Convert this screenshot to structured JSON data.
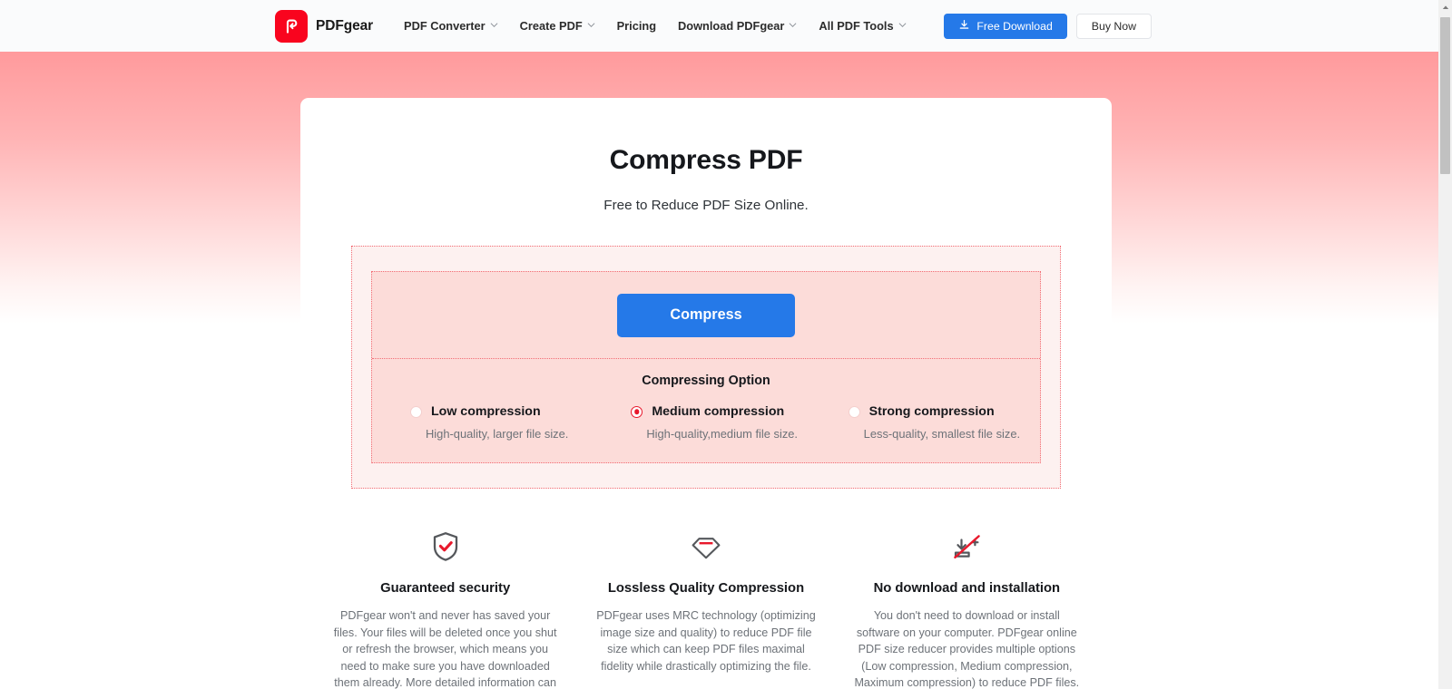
{
  "nav": {
    "brand": {
      "name": "PDFgear",
      "logo_icon": "pdfgear-logo-icon",
      "logo_color": "#f9041e"
    },
    "links": [
      {
        "label": "PDF Converter",
        "has_dropdown": true
      },
      {
        "label": "Create PDF",
        "has_dropdown": true
      },
      {
        "label": "Pricing",
        "has_dropdown": false
      },
      {
        "label": "Download PDFgear",
        "has_dropdown": true
      },
      {
        "label": "All PDF Tools",
        "has_dropdown": true
      }
    ],
    "free_download_label": "Free Download",
    "free_download_icon": "download-icon",
    "free_download_color": "#2579e8",
    "buy_now_label": "Buy Now"
  },
  "hero": {
    "title": "Compress PDF",
    "subtitle": "Free to Reduce PDF Size Online.",
    "gradient_top": "#ff9a9c",
    "gradient_bottom": "#ffffff"
  },
  "compress_panel": {
    "button_label": "Compress",
    "button_color": "#2579e8",
    "border_color": "#f26d75",
    "outer_fill": "#fdf1f0",
    "inner_fill": "#fcdcd9",
    "options_title": "Compressing Option",
    "options": [
      {
        "label": "Low compression",
        "description": "High-quality, larger file size.",
        "selected": false
      },
      {
        "label": "Medium compression",
        "description": "High-quality,medium file size.",
        "selected": true
      },
      {
        "label": "Strong compression",
        "description": "Less-quality, smallest file size.",
        "selected": false
      }
    ],
    "selected_color": "#e8192c"
  },
  "features": [
    {
      "icon": "shield-check-icon",
      "title": "Guaranteed security",
      "text": "PDFgear won't and never has saved your files. Your files will be deleted once you shut or refresh the browser, which means you need to make sure you have downloaded them already. More detailed information can"
    },
    {
      "icon": "diamond-icon",
      "title": "Lossless Quality Compression",
      "text": "PDFgear uses MRC technology (optimizing image size and quality) to reduce PDF file size which can keep PDF files maximal fidelity while drastically optimizing the file."
    },
    {
      "icon": "no-download-icon",
      "title": "No download and installation",
      "text": "You don't need to download or install software on your computer. PDFgear online PDF size reducer provides multiple options (Low compression, Medium compression, Maximum compression) to reduce PDF files."
    }
  ],
  "scrollbar": {
    "thumb_color": "#c1c1c1",
    "track_color": "#f1f1f1"
  }
}
